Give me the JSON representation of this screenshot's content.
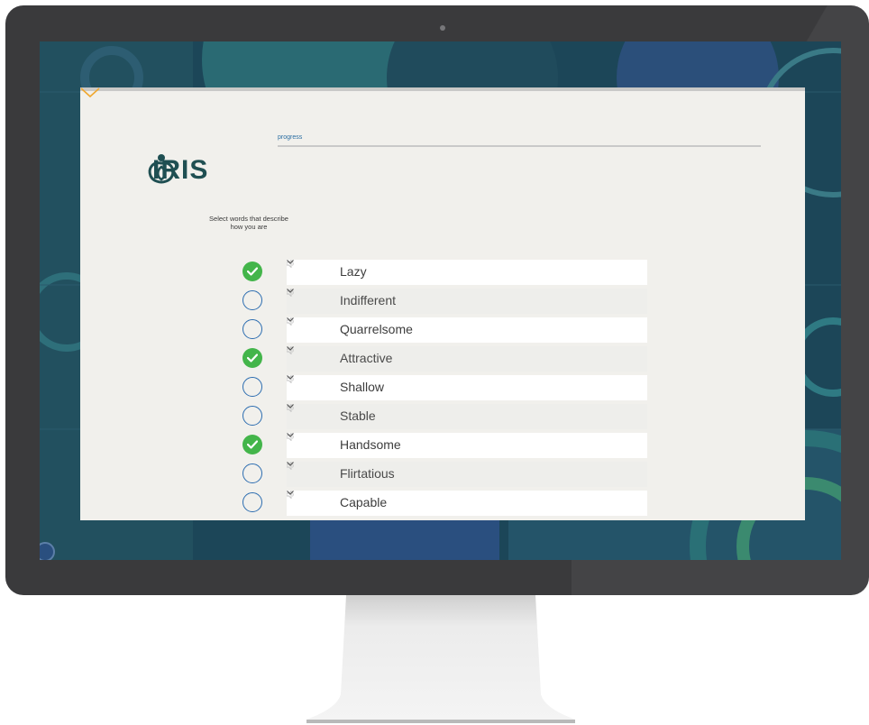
{
  "app": {
    "logo_text": "IRIS",
    "progress_label": "progress",
    "prompt_line1": "Select words that describe",
    "prompt_line2": "how you are"
  },
  "words": [
    {
      "label": "Lazy",
      "selected": true
    },
    {
      "label": "Indifferent",
      "selected": false
    },
    {
      "label": "Quarrelsome",
      "selected": false
    },
    {
      "label": "Attractive",
      "selected": true
    },
    {
      "label": "Shallow",
      "selected": false
    },
    {
      "label": "Stable",
      "selected": false
    },
    {
      "label": "Handsome",
      "selected": true
    },
    {
      "label": "Flirtatious",
      "selected": false
    },
    {
      "label": "Capable",
      "selected": false
    }
  ],
  "icons": {
    "speaker": "speaker-icon",
    "chevron": "chevron-down-icon",
    "check": "checkmark-icon"
  },
  "colors": {
    "accent_green": "#43b54a",
    "circle_blue": "#2b6cb0",
    "prompt_chevron": "#f0a830",
    "brand_teal": "#1f4f52",
    "progress_blue": "#2c6fa3"
  }
}
